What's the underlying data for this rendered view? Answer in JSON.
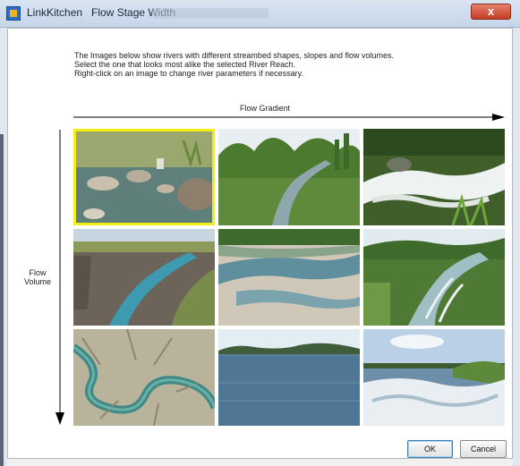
{
  "window": {
    "app_name": "LinkKitchen",
    "title": "Flow Stage Width",
    "close_label": "x"
  },
  "instructions": [
    "The Images below show rivers with different streambed shapes, slopes and flow volumes.",
    "Select the one that looks most alike the selected River Reach.",
    "Right-click on an image to change river parameters if necessary."
  ],
  "axes": {
    "gradient_label": "Flow Gradient",
    "volume_label_line1": "Flow",
    "volume_label_line2": "Volume"
  },
  "images": [
    {
      "id": "r1c1",
      "scene": "rocky-stream",
      "selected": true
    },
    {
      "id": "r1c2",
      "scene": "wooded-river",
      "selected": false
    },
    {
      "id": "r1c3",
      "scene": "cascade",
      "selected": false
    },
    {
      "id": "r2c1",
      "scene": "gorge",
      "selected": false
    },
    {
      "id": "r2c2",
      "scene": "braided-river",
      "selected": false
    },
    {
      "id": "r2c3",
      "scene": "rapid-river",
      "selected": false
    },
    {
      "id": "r3c1",
      "scene": "meander-delta",
      "selected": false
    },
    {
      "id": "r3c2",
      "scene": "wide-river",
      "selected": false
    },
    {
      "id": "r3c3",
      "scene": "big-rapids",
      "selected": false
    }
  ],
  "buttons": {
    "ok": "OK",
    "cancel": "Cancel"
  },
  "colors": {
    "selection": "#f5ee14",
    "titlebar": "#c6d6ea"
  }
}
